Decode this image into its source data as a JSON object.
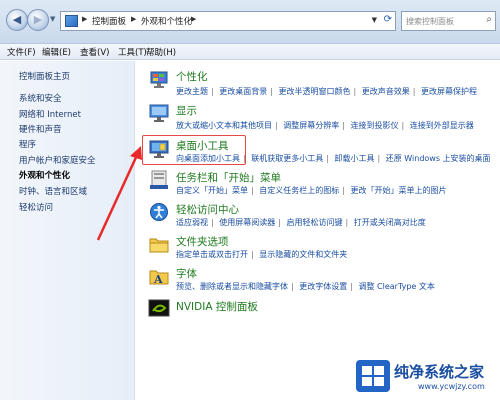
{
  "address_bar": {
    "breadcrumb": [
      "控制面板",
      "外观和个性化"
    ],
    "search_placeholder": "搜索控制面板"
  },
  "menu_bar": {
    "items": [
      "文件(F)",
      "编辑(E)",
      "查看(V)",
      "工具(T)",
      "帮助(H)"
    ]
  },
  "sidebar": {
    "items": [
      {
        "label": "控制面板主页",
        "active": false
      },
      {
        "label": "系统和安全",
        "active": false
      },
      {
        "label": "网络和 Internet",
        "active": false
      },
      {
        "label": "硬件和声音",
        "active": false
      },
      {
        "label": "程序",
        "active": false
      },
      {
        "label": "用户帐户和家庭安全",
        "active": false
      },
      {
        "label": "外观和个性化",
        "active": true
      },
      {
        "label": "时钟、语言和区域",
        "active": false
      },
      {
        "label": "轻松访问",
        "active": false
      }
    ]
  },
  "categories": [
    {
      "title": "个性化",
      "icon": "personalization-icon",
      "links": [
        "更改主题",
        "更改桌面背景",
        "更改半透明窗口颜色",
        "更改声音效果",
        "更改屏幕保护程"
      ]
    },
    {
      "title": "显示",
      "icon": "display-icon",
      "links": [
        "放大或缩小文本和其他项目",
        "调整屏幕分辨率",
        "连接到投影仪",
        "连接到外部显示器"
      ]
    },
    {
      "title": "桌面小工具",
      "icon": "desktop-gadgets-icon",
      "links": [
        "向桌面添加小工具",
        "联机获取更多小工具",
        "卸载小工具",
        "还原 Windows 上安装的桌面"
      ]
    },
    {
      "title": "任务栏和「开始」菜单",
      "icon": "taskbar-icon",
      "links": [
        "自定义「开始」菜单",
        "自定义任务栏上的图标",
        "更改「开始」菜单上的图片"
      ]
    },
    {
      "title": "轻松访问中心",
      "icon": "ease-of-access-icon",
      "links": [
        "适应弱视",
        "使用屏幕阅读器",
        "启用轻松访问键",
        "打开或关闭高对比度"
      ]
    },
    {
      "title": "文件夹选项",
      "icon": "folder-options-icon",
      "links": [
        "指定单击或双击打开",
        "显示隐藏的文件和文件夹"
      ]
    },
    {
      "title": "字体",
      "icon": "fonts-icon",
      "links": [
        "预览、删除或者显示和隐藏字体",
        "更改字体设置",
        "调整 ClearType 文本"
      ]
    },
    {
      "title": "NVIDIA 控制面板",
      "icon": "nvidia-icon",
      "links": []
    }
  ],
  "watermark": {
    "title": "纯净系统之家",
    "url": "www.ycwjzy.com"
  },
  "colors": {
    "category_title": "#1f7a1f",
    "link": "#1a4ea1",
    "highlight": "#e84848"
  }
}
